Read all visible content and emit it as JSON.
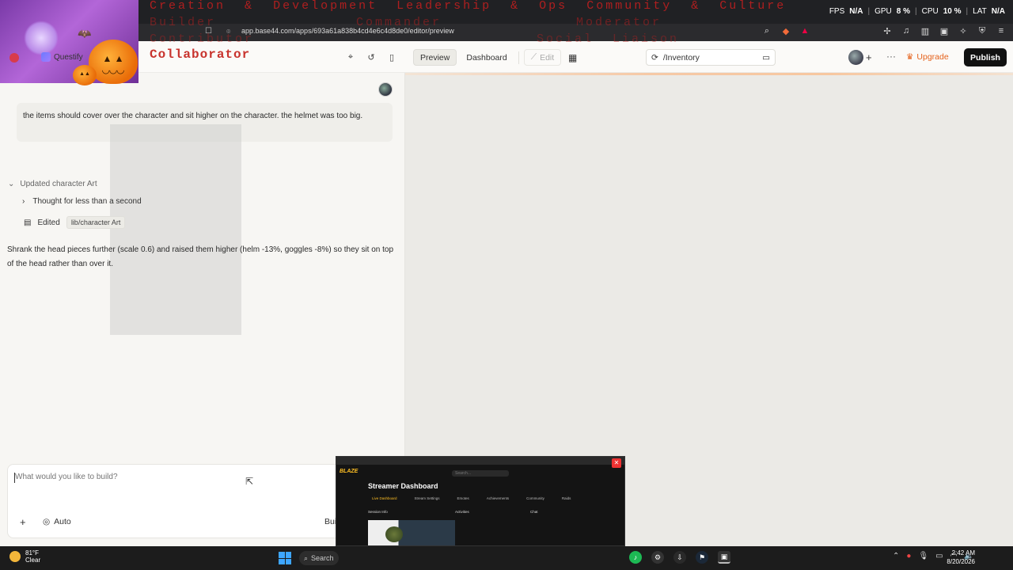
{
  "browser": {
    "url": "app.base44.com/apps/693a61a838b4cd4e6c4d8de0/editor/preview",
    "stats": {
      "fps_label": "FPS",
      "fps_value": "N/A",
      "gpu_label": "GPU",
      "gpu_value": "8 %",
      "cpu_label": "CPU",
      "cpu_value": "10 %",
      "lat_label": "LAT",
      "lat_value": "N/A"
    }
  },
  "overlay": {
    "line1": [
      "Creation",
      "&",
      "Development",
      "Leadership",
      "&",
      "Ops",
      "Community",
      "&",
      "Culture"
    ],
    "line2": [
      "Builder",
      "Commander",
      "Moderator"
    ],
    "line3": [
      "Contributor",
      "Social",
      "Liaison"
    ],
    "collaborator": "Collaborator"
  },
  "app": {
    "brand": "Questify",
    "nav": {
      "preview": "Preview",
      "dashboard": "Dashboard",
      "edit": "Edit"
    },
    "route": "/Inventory",
    "upgrade": "Upgrade",
    "publish": "Publish"
  },
  "chat": {
    "user_message": "the items should cover over the character and sit higher on the character. the helmet was too big.",
    "step_title": "Updated character Art",
    "thought": "Thought for less than a second",
    "edited_label": "Edited",
    "edited_file": "lib/character Art",
    "assistant_message": "Shrank the head pieces further (scale 0.6) and raised them higher (helm -13%, goggles -8%) so they sit on top of the head rather than over it.",
    "composer_placeholder": "What would you like to build?",
    "mode": "Auto",
    "build_label": "Bui"
  },
  "thumbnail": {
    "logo": "BLAZE",
    "search": "Search...",
    "title": "Streamer Dashboard",
    "tabs": [
      "Live Dashboard",
      "Stream Settings",
      "Emotes",
      "Achievements",
      "Community",
      "Raids"
    ],
    "row": [
      "Session Info",
      "Activities",
      "Chat"
    ]
  },
  "taskbar": {
    "temp": "81°F",
    "condition": "Clear",
    "search": "Search",
    "time": "2:42 AM",
    "date": "8/20/2026"
  },
  "colors": {
    "accent": "#e5621c",
    "publish_bg": "#111111",
    "overlay_red": "#c8332d"
  }
}
